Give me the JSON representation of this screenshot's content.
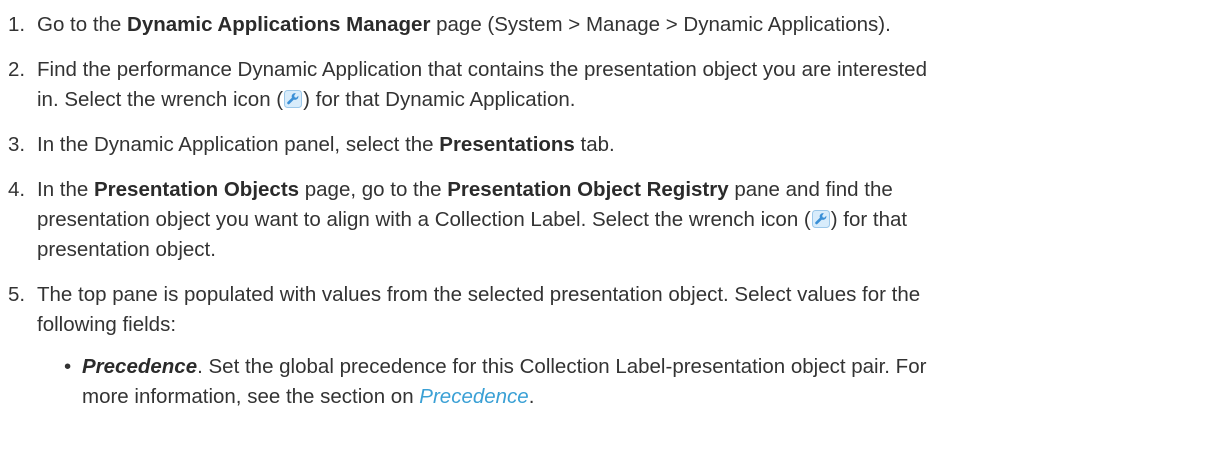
{
  "steps": [
    {
      "num": "1.",
      "t1": "Go to the ",
      "b1": "Dynamic Applications Manager",
      "t2": " page (System > Manage > Dynamic Applications)."
    },
    {
      "num": "2.",
      "t1": "Find the performance Dynamic Application that contains the presentation object you are interested",
      "t2": "in. Select the wrench icon (",
      "t3": ") for that Dynamic Application."
    },
    {
      "num": "3.",
      "t1": "In the Dynamic Application panel, select the ",
      "b1": "Presentations",
      "t2": " tab."
    },
    {
      "num": "4.",
      "t1": "In the ",
      "b1": "Presentation Objects",
      "t2": " page, go to the ",
      "b2": "Presentation Object Registry",
      "t3": " pane and find the",
      "t4": "presentation object you want to align with a Collection Label. Select the wrench icon (",
      "t5": ") for that",
      "t6": "presentation object."
    },
    {
      "num": "5.",
      "t1": "The top pane is populated with values from the selected presentation object. Select values for the",
      "t2": "following fields:",
      "bullets": [
        {
          "dot": "•",
          "term": "Precedence",
          "t1": ". Set the global precedence for this Collection Label-presentation object pair. For",
          "t2": "more information, see the section on ",
          "link": "Precedence",
          "t3": "."
        }
      ]
    }
  ],
  "icons": {
    "wrench": "wrench-icon",
    "wrench_color": "#3a8fd6",
    "link_color": "#3aa0d5"
  }
}
